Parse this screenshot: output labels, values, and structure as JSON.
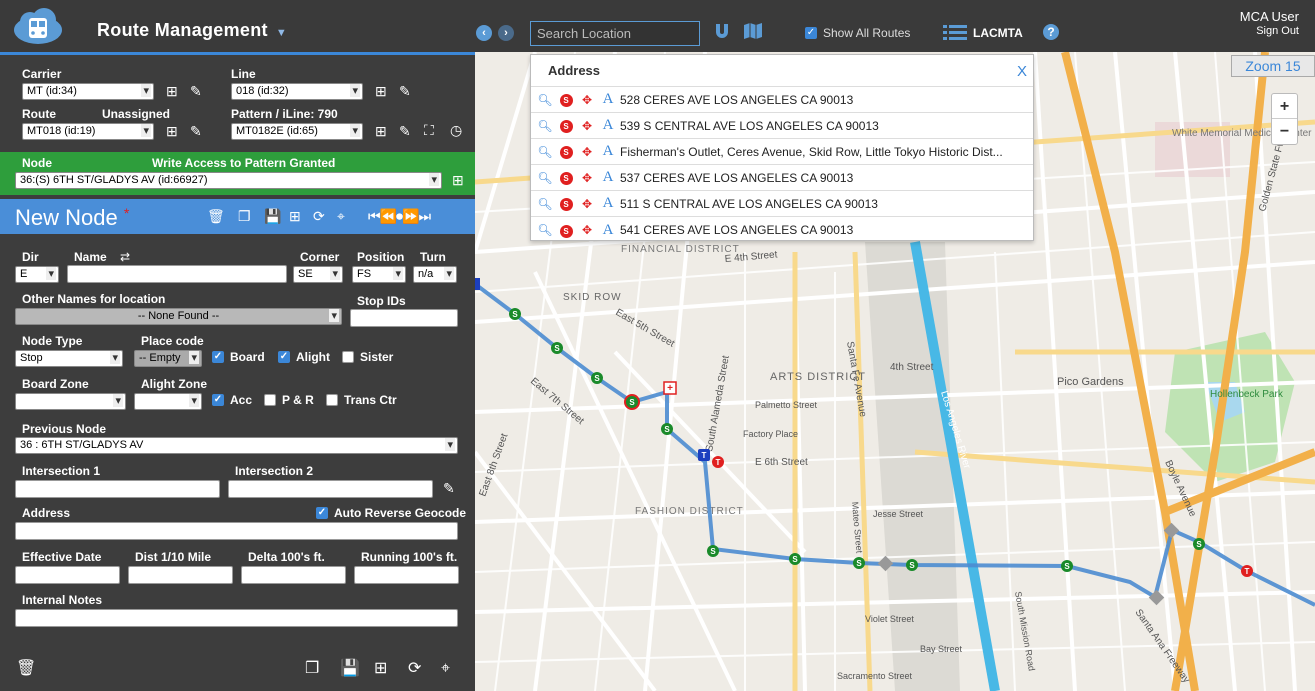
{
  "app": {
    "title": "Route Management",
    "user": "MCA User",
    "sign_out": "Sign Out",
    "agency": "LACMTA",
    "show_all_routes": "Show All Routes"
  },
  "search": {
    "placeholder": "Search Location"
  },
  "carrier": {
    "label": "Carrier",
    "value": "MT (id:34)"
  },
  "line": {
    "label": "Line",
    "value": "018 (id:32)"
  },
  "route": {
    "label": "Route",
    "unassigned": "Unassigned",
    "value": "MT018 (id:19)"
  },
  "pattern": {
    "label": "Pattern / iLine: 790",
    "value": "MT0182E (id:65)"
  },
  "node": {
    "label": "Node",
    "access": "Write Access to Pattern Granted",
    "value": "36:(S) 6TH ST/GLADYS AV (id:66927)"
  },
  "editor": {
    "title": "New Node",
    "required_mark": "*"
  },
  "form": {
    "dir_label": "Dir",
    "dir_value": "E",
    "name_label": "Name",
    "corner_label": "Corner",
    "corner_value": "SE",
    "position_label": "Position",
    "position_value": "FS",
    "turn_label": "Turn",
    "turn_value": "n/a",
    "other_names_label": "Other Names for location",
    "other_names_value": "-- None Found --",
    "stop_ids_label": "Stop IDs",
    "node_type_label": "Node Type",
    "node_type_value": "Stop",
    "place_code_label": "Place code",
    "place_code_value": "-- Empty",
    "board": "Board",
    "alight": "Alight",
    "sister": "Sister",
    "board_zone_label": "Board Zone",
    "alight_zone_label": "Alight Zone",
    "acc": "Acc",
    "pr": "P & R",
    "trans_ctr": "Trans Ctr",
    "previous_node_label": "Previous Node",
    "previous_node_value": "36 : 6TH ST/GLADYS AV",
    "intersection1_label": "Intersection 1",
    "intersection2_label": "Intersection 2",
    "address_label": "Address",
    "auto_reverse": "Auto Reverse Geocode",
    "effective_date_label": "Effective Date",
    "dist_label": "Dist 1/10 Mile",
    "delta_label": "Delta 100's ft.",
    "running_label": "Running 100's ft.",
    "notes_label": "Internal Notes"
  },
  "address_results": {
    "header": "Address",
    "close": "X",
    "rows": [
      "528 CERES AVE LOS ANGELES CA 90013",
      "539 S CENTRAL AVE LOS ANGELES CA 90013",
      "Fisherman's Outlet, Ceres Avenue, Skid Row, Little Tokyo Historic Dist...",
      "537 CERES AVE LOS ANGELES CA 90013",
      "511 S CENTRAL AVE LOS ANGELES CA 90013",
      "541 CERES AVE LOS ANGELES CA 90013"
    ]
  },
  "map": {
    "zoom": "Zoom 15",
    "zoom_in": "+",
    "zoom_out": "−",
    "labels": {
      "arts": "ARTS DISTRICT",
      "skid": "SKID ROW",
      "pico": "Pico Gardens",
      "hollenbeck": "Hollenbeck Park",
      "white": "White Memorial Medical Center",
      "e6th": "E 6th Street",
      "e4th": "E 4th Street",
      "santafe": "Santa Fe Avenue",
      "alameda": "South Alameda Street",
      "lariver": "Los Angeles River",
      "fin": "FINANCIAL DISTRICT",
      "fashion": "FASHION DISTRICT",
      "fourth": "4th Street",
      "factory": "Factory Place",
      "palmetto": "Palmetto Street",
      "jesse": "Jesse Street",
      "violet": "Violet Street",
      "bay": "Bay Street",
      "sacramento": "Sacramento Street",
      "santaanafwy": "Santa Ana Freeway",
      "goldenstate": "Golden State Fwy",
      "boyle": "Boyle Avenue",
      "mateo": "Mateo Street",
      "mission": "South Mission Road",
      "e5th": "East 5th Street",
      "e7th": "East 7th Street",
      "e8th": "East 8th Street",
      "stop": "S",
      "timepoint": "T"
    }
  }
}
